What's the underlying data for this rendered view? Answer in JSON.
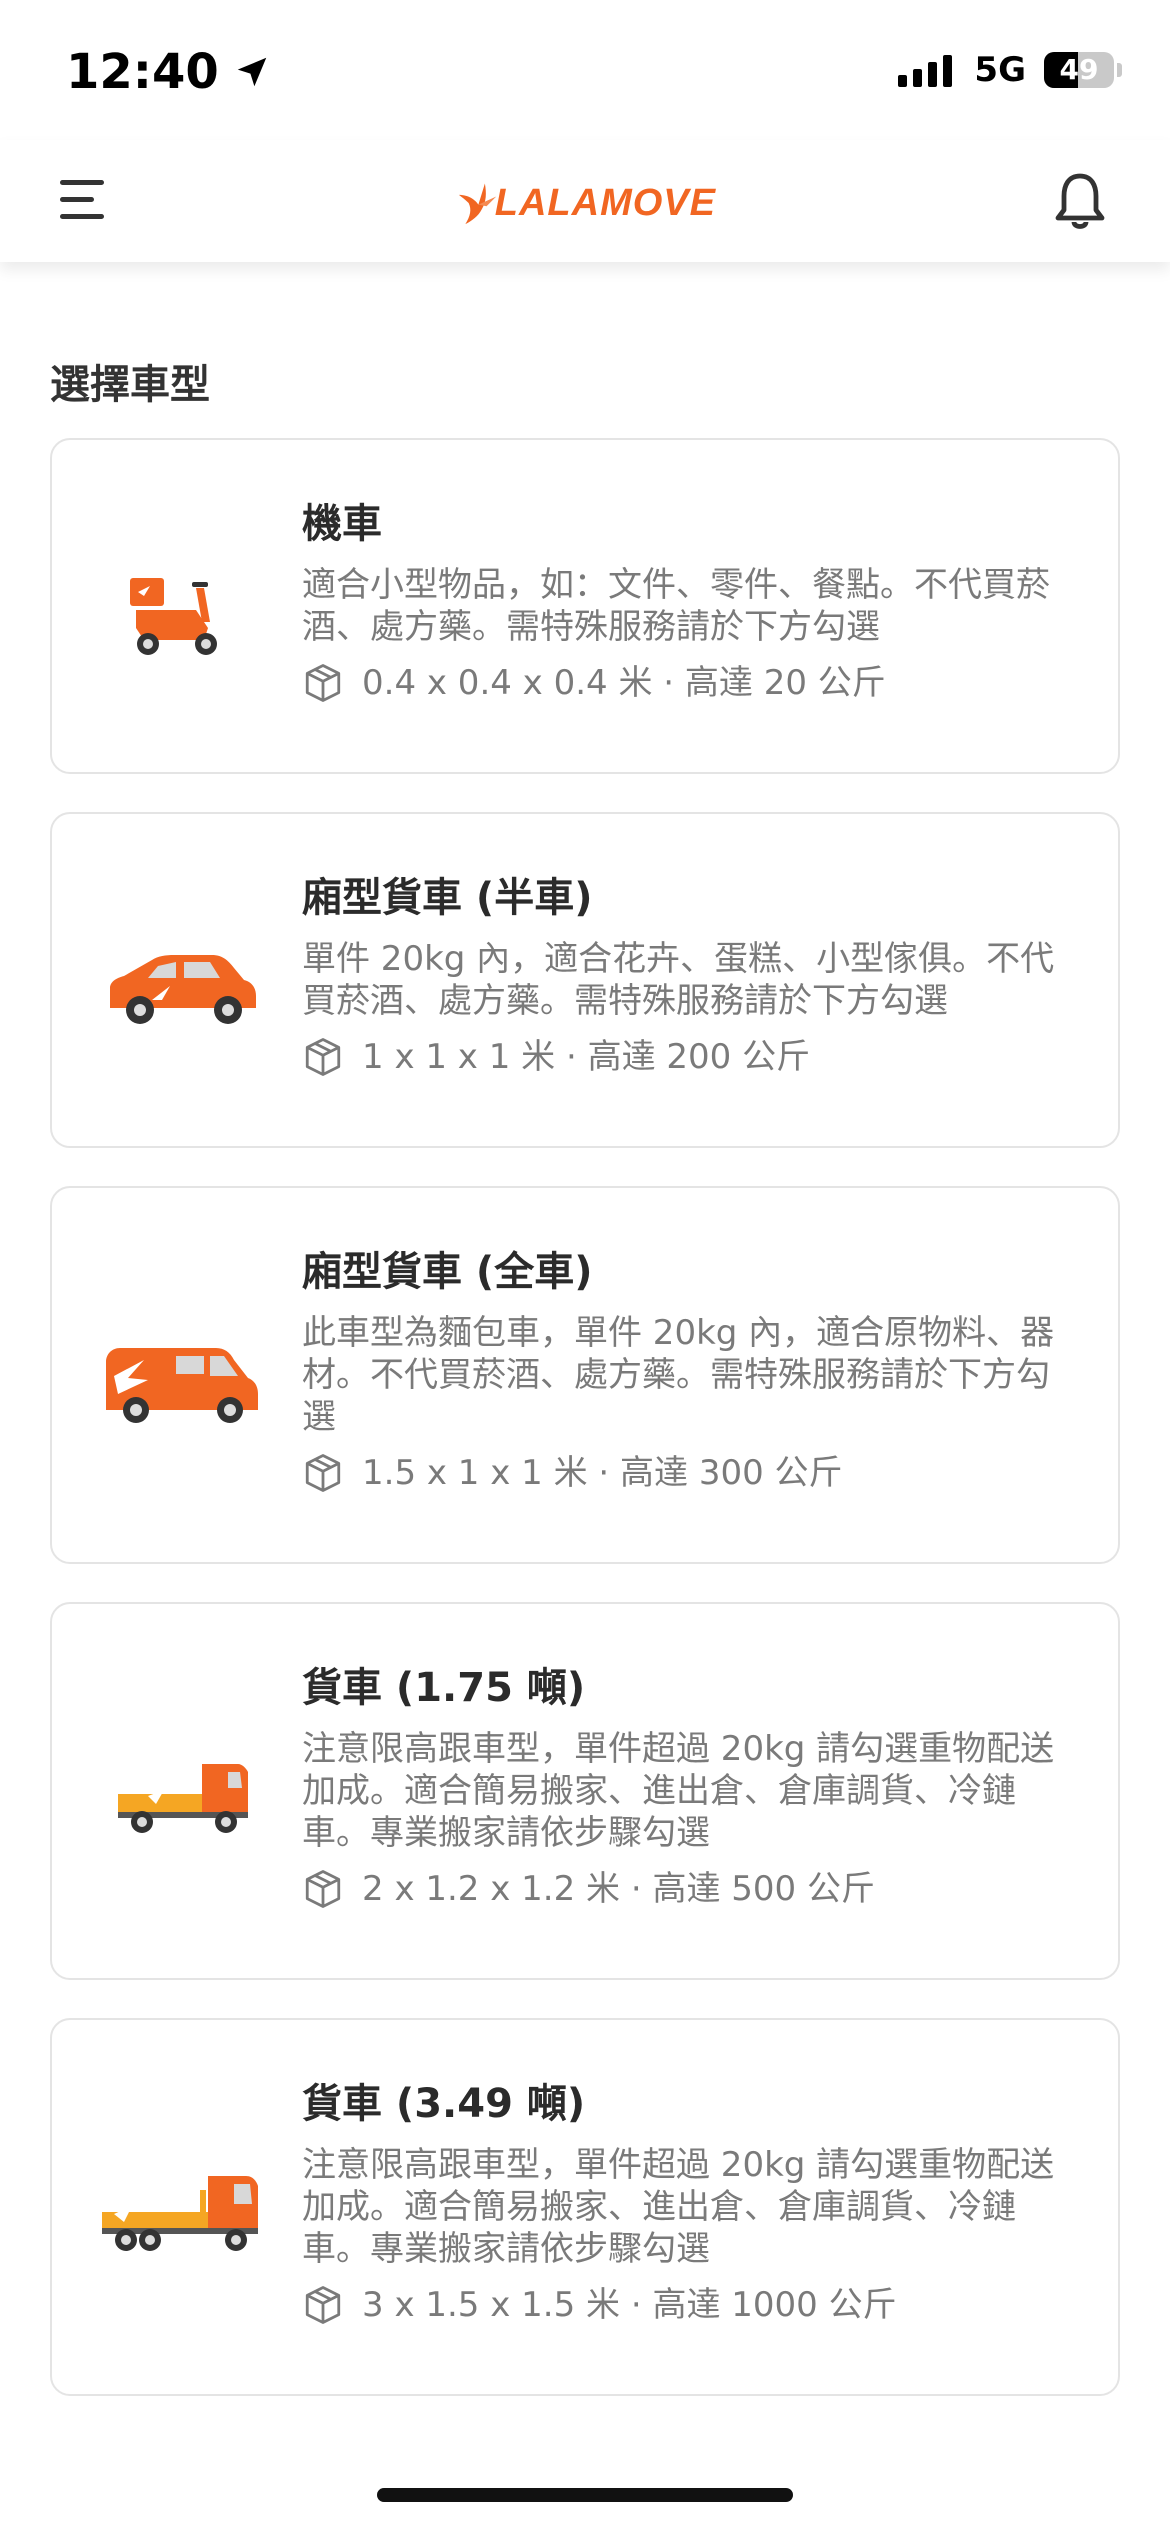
{
  "status_bar": {
    "time": "12:40",
    "network": "5G",
    "battery": "49",
    "battery_level": 0.49
  },
  "header": {
    "logo_text": "LALAMOVE"
  },
  "section_title": "選擇車型",
  "brand_color": "#f16622",
  "vehicles": [
    {
      "name": "機車",
      "desc": "適合小型物品，如：文件、零件、餐點。不代買菸酒、處方藥。需特殊服務請於下方勾選",
      "spec": "0.4 x 0.4 x 0.4 米 · 高達 20 公斤",
      "icon": "motorcycle-icon"
    },
    {
      "name": "廂型貨車 (半車)",
      "desc": "單件 20kg 內，適合花卉、蛋糕、小型傢俱。不代買菸酒、處方藥。需特殊服務請於下方勾選",
      "spec": "1 x 1 x 1 米 · 高達 200 公斤",
      "icon": "suv-icon"
    },
    {
      "name": "廂型貨車 (全車)",
      "desc": "此車型為麵包車，單件 20kg 內，適合原物料、器材。不代買菸酒、處方藥。需特殊服務請於下方勾選",
      "spec": "1.5 x 1 x 1 米 · 高達 300 公斤",
      "icon": "van-icon"
    },
    {
      "name": "貨車 (1.75 噸)",
      "desc": "注意限高跟車型，單件超過 20kg 請勾選重物配送加成。適合簡易搬家、進出倉、倉庫調貨、冷鏈車。專業搬家請依步驟勾選",
      "spec": "2 x 1.2 x 1.2 米 · 高達 500 公斤",
      "icon": "small-truck-icon"
    },
    {
      "name": "貨車 (3.49 噸)",
      "desc": "注意限高跟車型，單件超過 20kg 請勾選重物配送加成。適合簡易搬家、進出倉、倉庫調貨、冷鏈車。專業搬家請依步驟勾選",
      "spec": "3 x 1.5 x 1.5 米 · 高達 1000 公斤",
      "icon": "large-truck-icon"
    }
  ]
}
